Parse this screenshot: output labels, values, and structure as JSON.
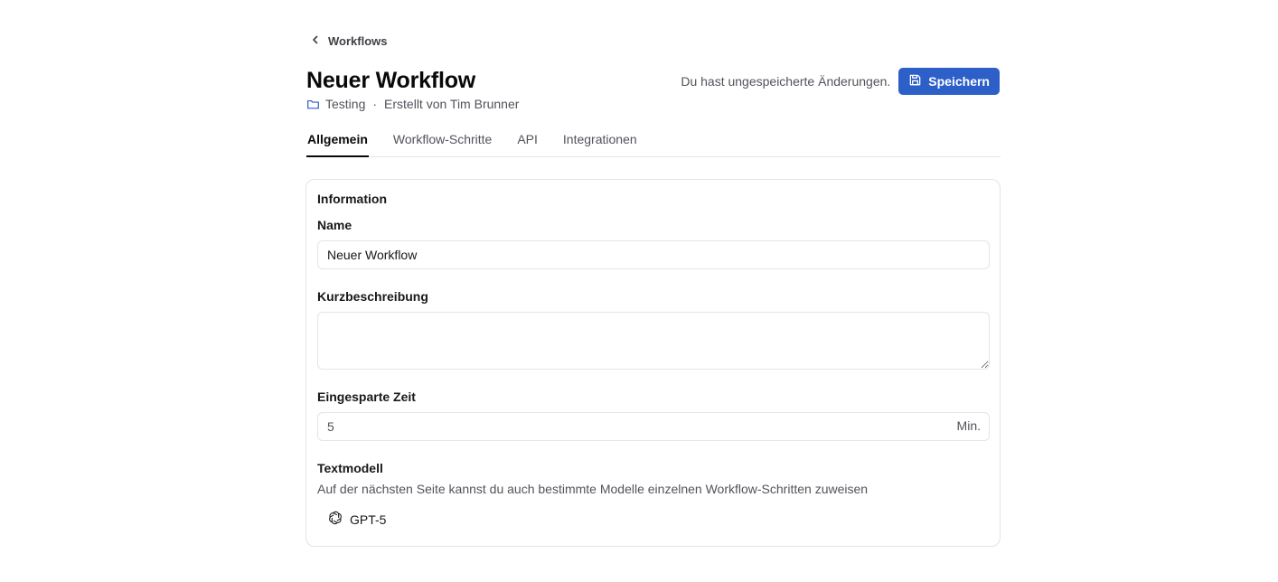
{
  "nav": {
    "back_label": "Workflows"
  },
  "header": {
    "title": "Neuer Workflow",
    "folder": "Testing",
    "separator": "·",
    "created_by": "Erstellt von Tim Brunner",
    "unsaved_notice": "Du hast ungespeicherte Änderungen.",
    "save_label": "Speichern"
  },
  "tabs": [
    {
      "label": "Allgemein",
      "active": true
    },
    {
      "label": "Workflow-Schritte",
      "active": false
    },
    {
      "label": "API",
      "active": false
    },
    {
      "label": "Integrationen",
      "active": false
    }
  ],
  "form": {
    "section_title": "Information",
    "name": {
      "label": "Name",
      "value": "Neuer Workflow"
    },
    "description": {
      "label": "Kurzbeschreibung",
      "value": ""
    },
    "saved_time": {
      "label": "Eingesparte Zeit",
      "value": "5",
      "unit": "Min."
    },
    "text_model": {
      "label": "Textmodell",
      "description": "Auf der nächsten Seite kannst du auch bestimmte Modelle einzelnen Workflow-Schritten zuweisen",
      "selected": "GPT-5"
    }
  },
  "colors": {
    "accent": "#2d5fc8",
    "border": "#e4e4e7"
  },
  "icons": {
    "back": "chevron-left-icon",
    "folder": "folder-icon",
    "save": "save-icon",
    "model": "openai-icon"
  }
}
